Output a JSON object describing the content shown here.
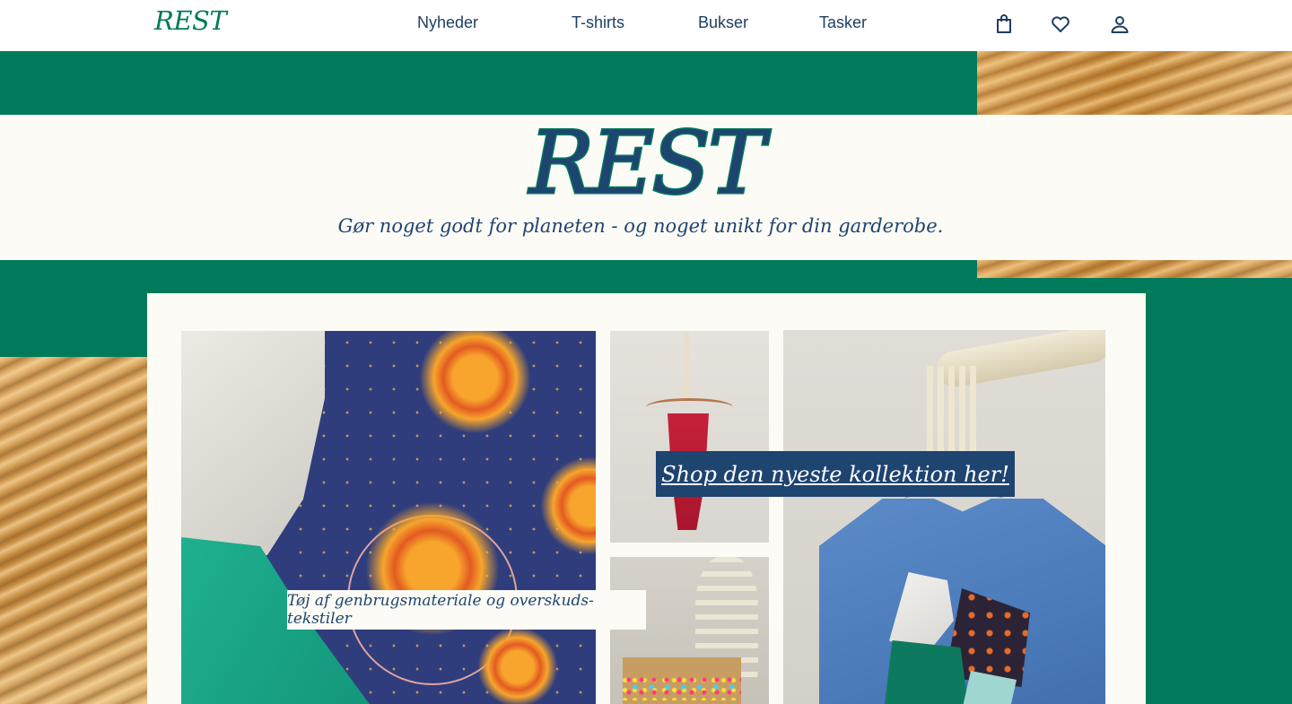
{
  "header": {
    "logo": "REST",
    "nav": [
      {
        "label": "Nyheder"
      },
      {
        "label": "T-shirts"
      },
      {
        "label": "Bukser"
      },
      {
        "label": "Tasker"
      }
    ],
    "icons": [
      "shopping-bag-icon",
      "heart-icon",
      "user-icon"
    ]
  },
  "hero": {
    "title": "REST",
    "tagline": "Gør noget godt for planeten - og noget unikt for din garderobe."
  },
  "collage": {
    "shop_label": "Shop den nyeste kollektion her!",
    "material_label": "Tøj af genbrugsmateriale og overskuds-tekstiler"
  },
  "colors": {
    "green": "#007a5a",
    "navy": "#1e4470",
    "cream": "#fcfbf5",
    "sand": "#c98f44"
  }
}
